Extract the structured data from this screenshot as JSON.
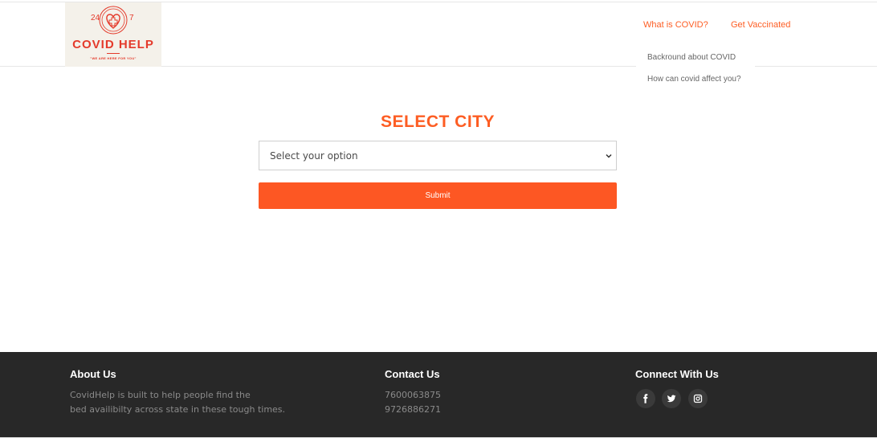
{
  "colors": {
    "accent": "#fd5d23",
    "footer_bg": "#282828",
    "logo_red": "#e43a2b"
  },
  "logo": {
    "num_left": "24",
    "num_right": "7",
    "title": "COVID HELP",
    "tagline": "\"WE ARE HERE FOR YOU\""
  },
  "nav": {
    "what_is_covid": "What is COVID?",
    "get_vaccinated": "Get Vaccinated",
    "dropdown": [
      "Backround about COVID",
      "How can covid affect you?"
    ]
  },
  "main": {
    "title": "SELECT CITY",
    "select_value": "Select your option",
    "submit_label": "Submit"
  },
  "footer": {
    "about_title": "About Us",
    "about_line1": "CovidHelp is built to help people find the",
    "about_line2": "bed availibilty across state in these tough times.",
    "contact_title": "Contact Us",
    "phone1": "7600063875",
    "phone2": "9726886271",
    "connect_title": "Connect With Us",
    "social_icons": [
      "facebook-icon",
      "twitter-icon",
      "instagram-icon"
    ]
  }
}
